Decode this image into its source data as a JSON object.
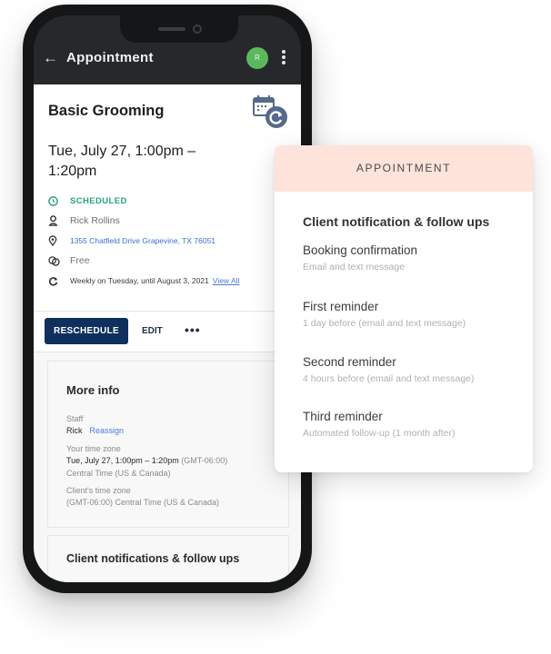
{
  "appbar": {
    "back_icon": "arrow-left-icon",
    "back_glyph": "←",
    "title": "Appointment",
    "avatar_initial": "R",
    "avatar_color": "#5cb85c",
    "menu_icon": "more-vertical-icon"
  },
  "appointment": {
    "service": "Basic Grooming",
    "service_icon": "calendar-reschedule-icon",
    "datetime": "Tue, July 27, 1:00pm – 1:20pm",
    "status": "SCHEDULED",
    "status_color": "#2aa37a",
    "client": "Rick Rollins",
    "address": "1355 Chatfield Drive Grapevine, TX 76051",
    "price": "Free",
    "recurrence": "Weekly on Tuesday, until August 3, 2021",
    "recurrence_link": "View All"
  },
  "actions": {
    "reschedule": "RESCHEDULE",
    "edit": "EDIT",
    "more": "•••",
    "primary_color": "#0f2f5c"
  },
  "more_info": {
    "title": "More info",
    "staff_label": "Staff",
    "staff_name": "Rick",
    "reassign": "Reassign",
    "your_tz_label": "Your time zone",
    "your_tz_time": "Tue, July 27, 1:00pm – 1:20pm",
    "your_tz_offset": "(GMT-06:00)",
    "your_tz_name": "Central Time (US & Canada)",
    "client_tz_label": "Client's time zone",
    "client_tz_value": "(GMT-06:00) Central Time (US & Canada)"
  },
  "notifications_card": {
    "title": "Client notifications & follow ups"
  },
  "panel": {
    "header": "APPOINTMENT",
    "header_color": "#fde3da",
    "title": "Client notification & follow ups",
    "items": [
      {
        "name": "Booking confirmation",
        "detail": "Email and text message"
      },
      {
        "name": "First reminder",
        "detail": "1 day before (email and text message)"
      },
      {
        "name": "Second reminder",
        "detail": "4 hours before (email and text message)"
      },
      {
        "name": "Third reminder",
        "detail": "Automated follow-up (1 month after)"
      }
    ]
  }
}
